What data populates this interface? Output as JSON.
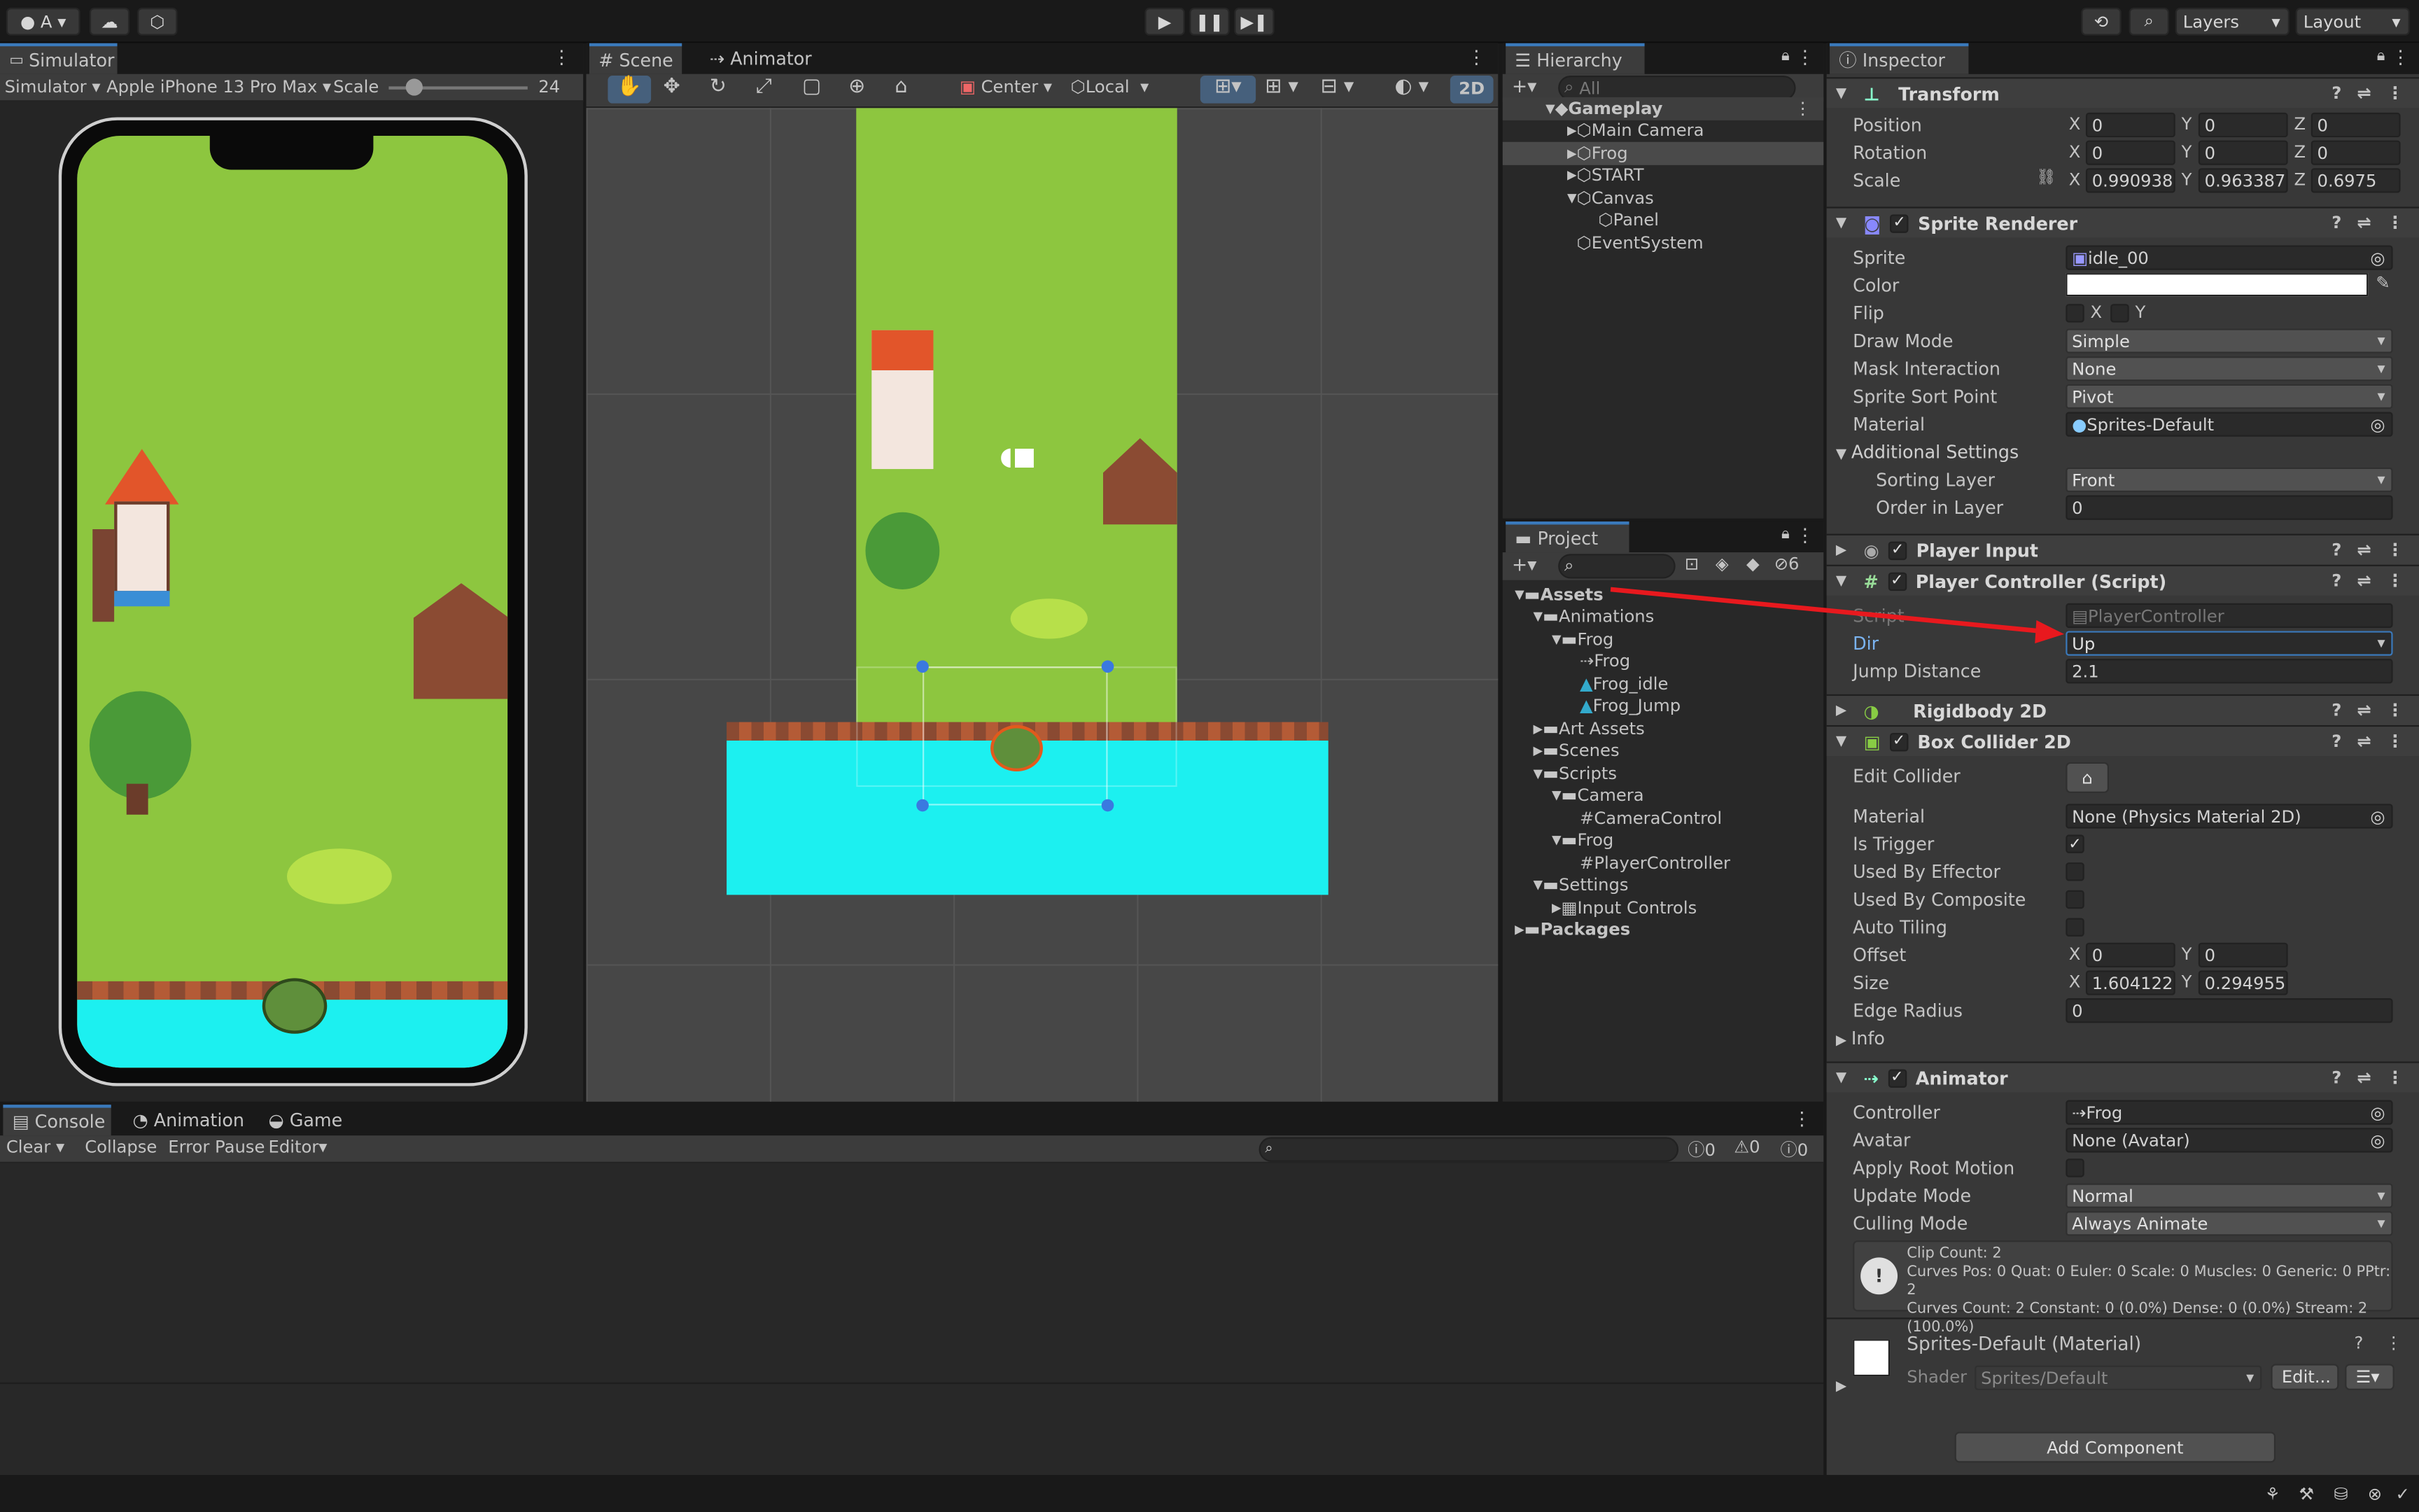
{
  "top": {
    "account": "A",
    "layers": "Layers",
    "layout": "Layout"
  },
  "simulator": {
    "tab": "Simulator",
    "mode": "Simulator",
    "device": "Apple iPhone 13 Pro Max",
    "scale_label": "Scale",
    "scale_value": "24"
  },
  "scene": {
    "tabs": [
      "Scene",
      "Animator"
    ],
    "pivot": "Center",
    "space": "Local",
    "mode2d": "2D"
  },
  "hierarchy": {
    "tab": "Hierarchy",
    "search": "All",
    "items": [
      {
        "label": "Gameplay",
        "indent": 0,
        "expanded": true,
        "bold": true
      },
      {
        "label": "Main Camera",
        "indent": 1,
        "arrow": true
      },
      {
        "label": "Frog",
        "indent": 1,
        "arrow": true,
        "selected": true
      },
      {
        "label": "START",
        "indent": 1,
        "arrow": true
      },
      {
        "label": "Canvas",
        "indent": 1,
        "expanded": true
      },
      {
        "label": "Panel",
        "indent": 2
      },
      {
        "label": "EventSystem",
        "indent": 1
      }
    ]
  },
  "project": {
    "tab": "Project",
    "hidden_count": "6",
    "items": [
      {
        "label": "Assets",
        "indent": 0,
        "type": "folder",
        "expanded": true,
        "bold": true
      },
      {
        "label": "Animations",
        "indent": 1,
        "type": "folder",
        "expanded": true
      },
      {
        "label": "Frog",
        "indent": 2,
        "type": "folder",
        "expanded": true
      },
      {
        "label": "Frog",
        "indent": 3,
        "type": "controller"
      },
      {
        "label": "Frog_idle",
        "indent": 3,
        "type": "anim"
      },
      {
        "label": "Frog_Jump",
        "indent": 3,
        "type": "anim"
      },
      {
        "label": "Art Assets",
        "indent": 1,
        "type": "folder",
        "collapsed": true
      },
      {
        "label": "Scenes",
        "indent": 1,
        "type": "folder",
        "collapsed": true
      },
      {
        "label": "Scripts",
        "indent": 1,
        "type": "folder",
        "expanded": true
      },
      {
        "label": "Camera",
        "indent": 2,
        "type": "folder",
        "expanded": true
      },
      {
        "label": "CameraControl",
        "indent": 3,
        "type": "script"
      },
      {
        "label": "Frog",
        "indent": 2,
        "type": "folder",
        "expanded": true
      },
      {
        "label": "PlayerController",
        "indent": 3,
        "type": "script"
      },
      {
        "label": "Settings",
        "indent": 1,
        "type": "folder",
        "expanded": true
      },
      {
        "label": "Input Controls",
        "indent": 2,
        "type": "input",
        "collapsed": true
      },
      {
        "label": "Packages",
        "indent": 0,
        "type": "folder",
        "collapsed": true,
        "bold": true
      }
    ]
  },
  "console": {
    "tabs": [
      "Console",
      "Animation",
      "Game"
    ],
    "clear": "Clear",
    "collapse": "Collapse",
    "error_pause": "Error Pause",
    "editor": "Editor",
    "counts": [
      "0",
      "0",
      "0"
    ]
  },
  "inspector": {
    "tab": "Inspector",
    "transform": {
      "title": "Transform",
      "position_label": "Position",
      "rotation_label": "Rotation",
      "scale_label": "Scale",
      "position": [
        "0",
        "0",
        "0"
      ],
      "rotation": [
        "0",
        "0",
        "0"
      ],
      "scale": [
        "0.990938",
        "0.963387",
        "0.6975"
      ]
    },
    "sprite_renderer": {
      "title": "Sprite Renderer",
      "sprite_label": "Sprite",
      "sprite": "idle_00",
      "color_label": "Color",
      "flip_label": "Flip",
      "flip_x": "X",
      "flip_y": "Y",
      "draw_mode_label": "Draw Mode",
      "draw_mode": "Simple",
      "mask_label": "Mask Interaction",
      "mask": "None",
      "sort_point_label": "Sprite Sort Point",
      "sort_point": "Pivot",
      "material_label": "Material",
      "material": "Sprites-Default",
      "additional": "Additional Settings",
      "sorting_layer_label": "Sorting Layer",
      "sorting_layer": "Front",
      "order_label": "Order in Layer",
      "order": "0"
    },
    "player_input": {
      "title": "Player Input"
    },
    "player_controller": {
      "title": "Player Controller (Script)",
      "script_label": "Script",
      "script": "PlayerController",
      "dir_label": "Dir",
      "dir": "Up",
      "jump_label": "Jump Distance",
      "jump": "2.1"
    },
    "rigidbody": {
      "title": "Rigidbody 2D"
    },
    "box_collider": {
      "title": "Box Collider 2D",
      "edit_label": "Edit Collider",
      "material_label": "Material",
      "material": "None (Physics Material 2D)",
      "trigger_label": "Is Trigger",
      "effector_label": "Used By Effector",
      "composite_label": "Used By Composite",
      "tiling_label": "Auto Tiling",
      "offset_label": "Offset",
      "offset": [
        "0",
        "0"
      ],
      "size_label": "Size",
      "size": [
        "1.604122",
        "0.294955"
      ],
      "edge_label": "Edge Radius",
      "edge": "0",
      "info_label": "Info"
    },
    "animator": {
      "title": "Animator",
      "controller_label": "Controller",
      "controller": "Frog",
      "avatar_label": "Avatar",
      "avatar": "None (Avatar)",
      "root_label": "Apply Root Motion",
      "update_label": "Update Mode",
      "update": "Normal",
      "culling_label": "Culling Mode",
      "culling": "Always Animate",
      "info_lines": [
        "Clip Count: 2",
        "Curves Pos: 0 Quat: 0 Euler: 0 Scale: 0 Muscles: 0 Generic: 0 PPtr: 2",
        "Curves Count: 2 Constant: 0 (0.0%) Dense: 0 (0.0%) Stream: 2 (100.0%)"
      ]
    },
    "material": {
      "title": "Sprites-Default (Material)",
      "shader_label": "Shader",
      "shader": "Sprites/Default",
      "edit": "Edit..."
    },
    "add_component": "Add Component",
    "axis": {
      "x": "X",
      "y": "Y",
      "z": "Z"
    }
  },
  "colors": {
    "accent": "#3a79bb",
    "grass": "#8dc63f",
    "water": "#1cf0f0",
    "arrow": "#e8191e",
    "panel": "#282828",
    "header": "#3e3e3e"
  }
}
